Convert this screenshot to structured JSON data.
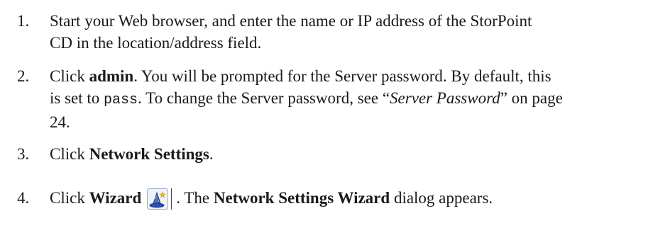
{
  "steps": [
    {
      "number": "1.",
      "line1": "Start your Web browser, and enter the name or IP address of the StorPoint",
      "line2": "CD in the location/address field."
    },
    {
      "number": "2.",
      "pre": "Click ",
      "bold": "admin",
      "post": ". You will be prompted for the Server password. By default, this",
      "line2_pre": "is set to ",
      "code": "pass",
      "line2_mid": ". To change the Server password, see “",
      "link": "Server Password",
      "line2_post": "” on page",
      "line3": "24."
    },
    {
      "number": "3.",
      "pre": "Click ",
      "bold": "Network Settings",
      "post": "."
    },
    {
      "number": "4.",
      "pre": "Click ",
      "bold": "Wizard",
      "icon": "wizard-hat-icon",
      "post_pre": ". The ",
      "bold2": "Network Settings Wizard",
      "post": " dialog appears."
    }
  ]
}
